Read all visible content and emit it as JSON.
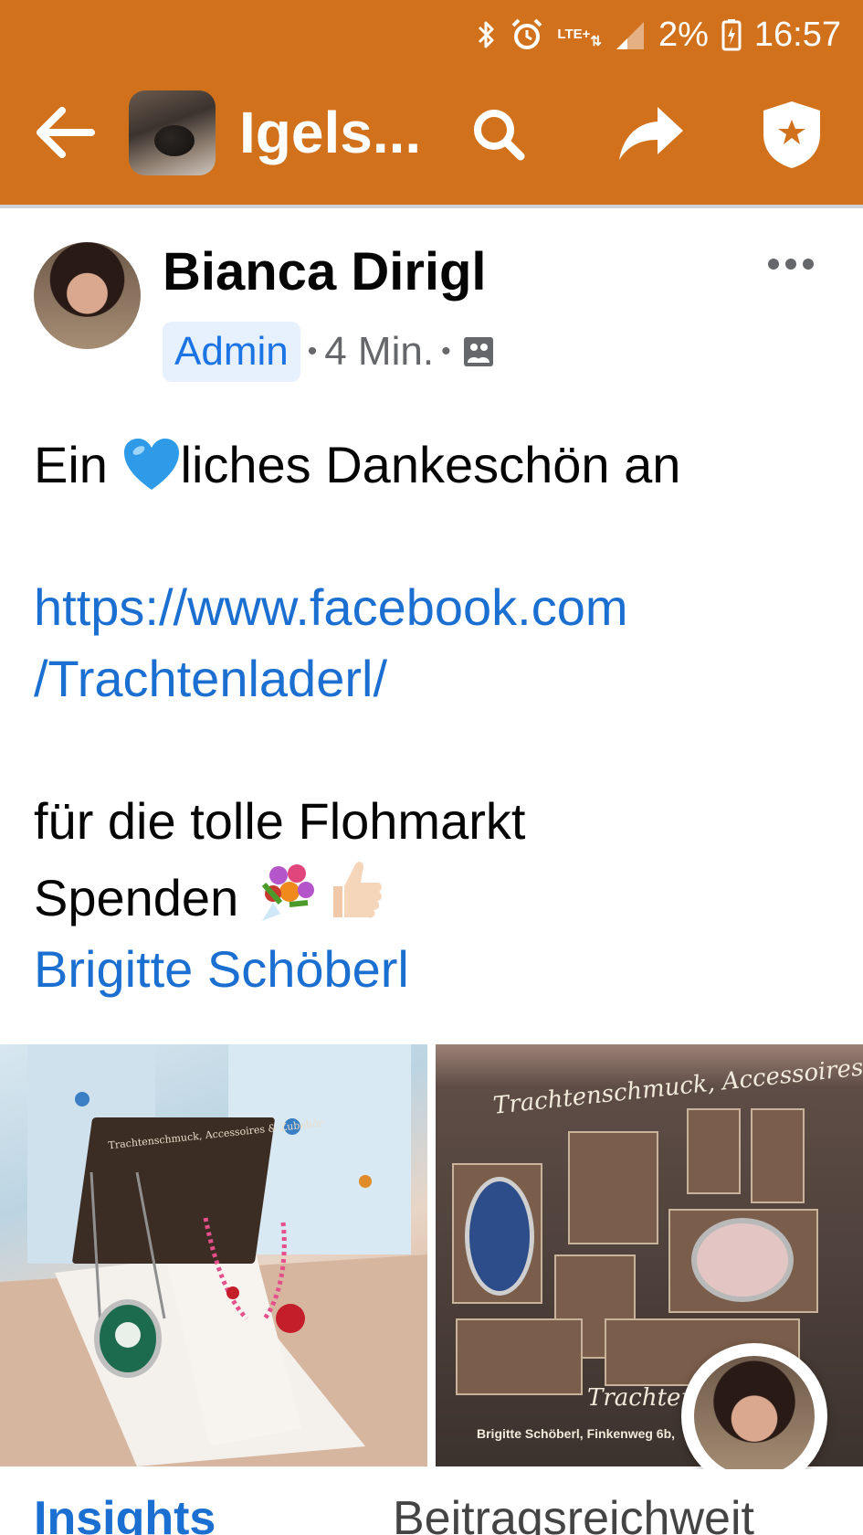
{
  "status_bar": {
    "battery_percent": "2%",
    "time": "16:57",
    "network": "LTE+",
    "icons": [
      "bluetooth-icon",
      "alarm-icon",
      "signal-icon",
      "battery-charging-icon"
    ]
  },
  "header": {
    "title": "Igels...",
    "icons": [
      "back-arrow-icon",
      "search-icon",
      "share-icon",
      "admin-shield-icon"
    ],
    "background_color": "#D2711C"
  },
  "post": {
    "author": "Bianca Dirigl",
    "role_badge": "Admin",
    "separator": "•",
    "time": "4 Min.",
    "visibility_icon": "photo-album-icon",
    "text_line1_prefix": "Ein",
    "text_line1_suffix": "liches Dankeschön an",
    "link_line1": "https://www.facebook.com",
    "link_line2": "/Trachtenladerl/",
    "text_line3": "für die tolle Flohmarkt",
    "text_line4": "Spenden",
    "tagged_name": "Brigitte Schöberl",
    "emojis": [
      "blue-heart-icon",
      "bouquet-icon",
      "thumbs-up-icon"
    ]
  },
  "photos": {
    "left_card_title": "Trachtenschmuck, Accessoires & Zubehör",
    "right_card_title": "Trachtenschmuck, Accessoires &",
    "right_brand": "Trachtenl",
    "right_address": "Brigitte Schöberl, Finkenweg 6b,"
  },
  "bottom_tabs": {
    "insights": "Insights",
    "reach": "Beitragsreichweit"
  },
  "colors": {
    "accent": "#D2711C",
    "link": "#1b6fd0",
    "admin_badge_bg": "#e7f0fd"
  }
}
